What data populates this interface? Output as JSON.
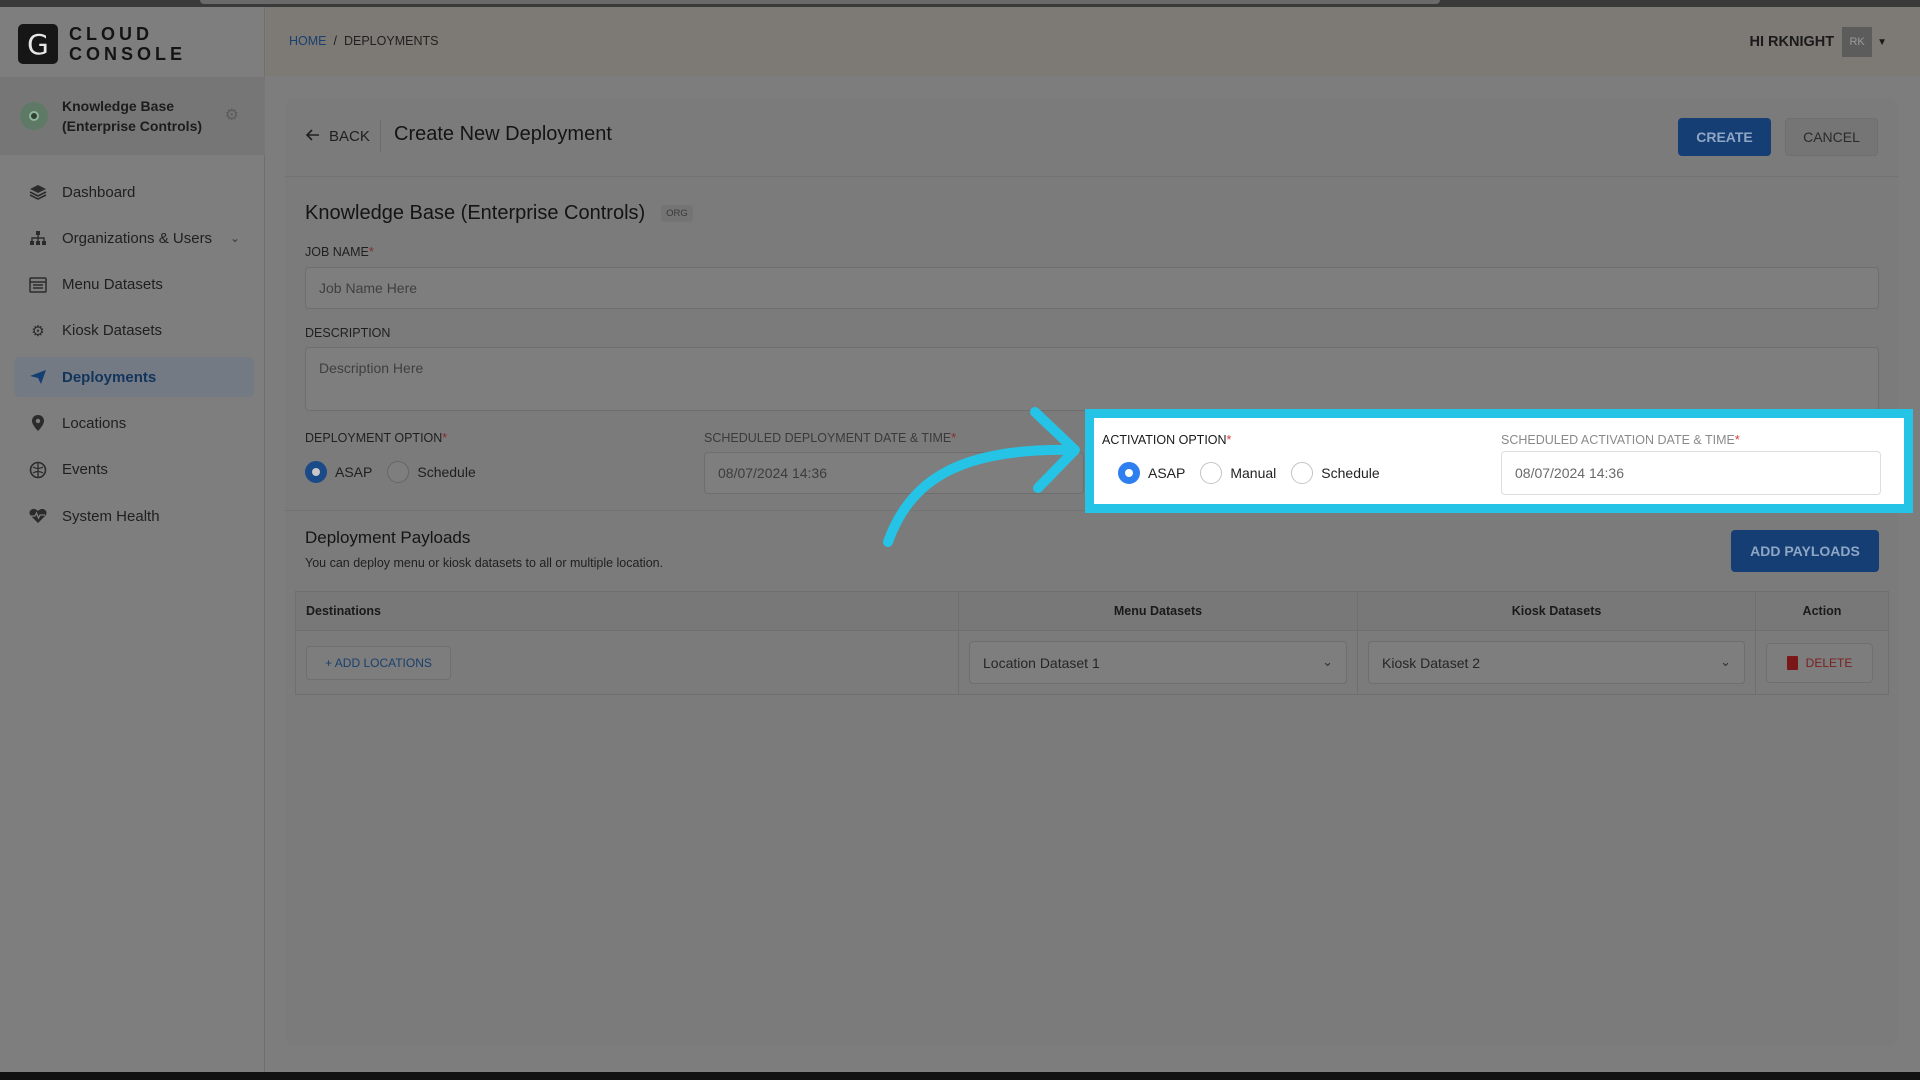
{
  "app": {
    "logo_letter": "G",
    "logo_line1": "CLOUD",
    "logo_line2": "CONSOLE"
  },
  "org": {
    "name": "Knowledge Base (Enterprise Controls)"
  },
  "sidebar": {
    "items": [
      {
        "label": "Dashboard",
        "icon": "layers-icon"
      },
      {
        "label": "Organizations & Users",
        "icon": "org-chart-icon"
      },
      {
        "label": "Menu Datasets",
        "icon": "menu-icon"
      },
      {
        "label": "Kiosk Datasets",
        "icon": "kiosk-gear-icon"
      },
      {
        "label": "Deployments",
        "icon": "paper-plane-icon"
      },
      {
        "label": "Locations",
        "icon": "map-pin-icon"
      },
      {
        "label": "Events",
        "icon": "events-icon"
      },
      {
        "label": "System Health",
        "icon": "heart-pulse-icon"
      }
    ]
  },
  "header": {
    "breadcrumb_home": "HOME",
    "breadcrumb_sep": "/",
    "breadcrumb_current": "DEPLOYMENTS",
    "greeting": "HI RKNIGHT",
    "avatar_initials": "RK"
  },
  "page": {
    "back_label": "BACK",
    "title": "Create New Deployment",
    "create_label": "CREATE",
    "cancel_label": "CANCEL"
  },
  "form": {
    "title": "Knowledge Base (Enterprise Controls)",
    "badge": "ORG",
    "job_name_label": "JOB NAME",
    "job_name_placeholder": "Job Name Here",
    "description_label": "DESCRIPTION",
    "description_placeholder": "Description Here",
    "deployment_option_label": "DEPLOYMENT OPTION",
    "deployment_options": [
      "ASAP",
      "Schedule"
    ],
    "scheduled_deployment_label": "SCHEDULED DEPLOYMENT DATE & TIME",
    "scheduled_deployment_value": "08/07/2024 14:36",
    "activation_option_label": "ACTIVATION OPTION",
    "activation_options": [
      "ASAP",
      "Manual",
      "Schedule"
    ],
    "scheduled_activation_label": "SCHEDULED ACTIVATION DATE & TIME",
    "scheduled_activation_value": "08/07/2024 14:36"
  },
  "payloads": {
    "title": "Deployment Payloads",
    "subtitle": "You can deploy menu or kiosk datasets to all or multiple location.",
    "add_label": "ADD PAYLOADS",
    "columns": [
      "Destinations",
      "Menu Datasets",
      "Kiosk Datasets",
      "Action"
    ],
    "rows": [
      {
        "add_locations": "+ ADD LOCATIONS",
        "menu": "Location Dataset 1",
        "kiosk": "Kiosk Dataset 2",
        "action": "DELETE"
      }
    ]
  },
  "colors": {
    "highlight": "#25c3e6",
    "primary": "#2f7ff0",
    "required": "#d83b3b"
  }
}
